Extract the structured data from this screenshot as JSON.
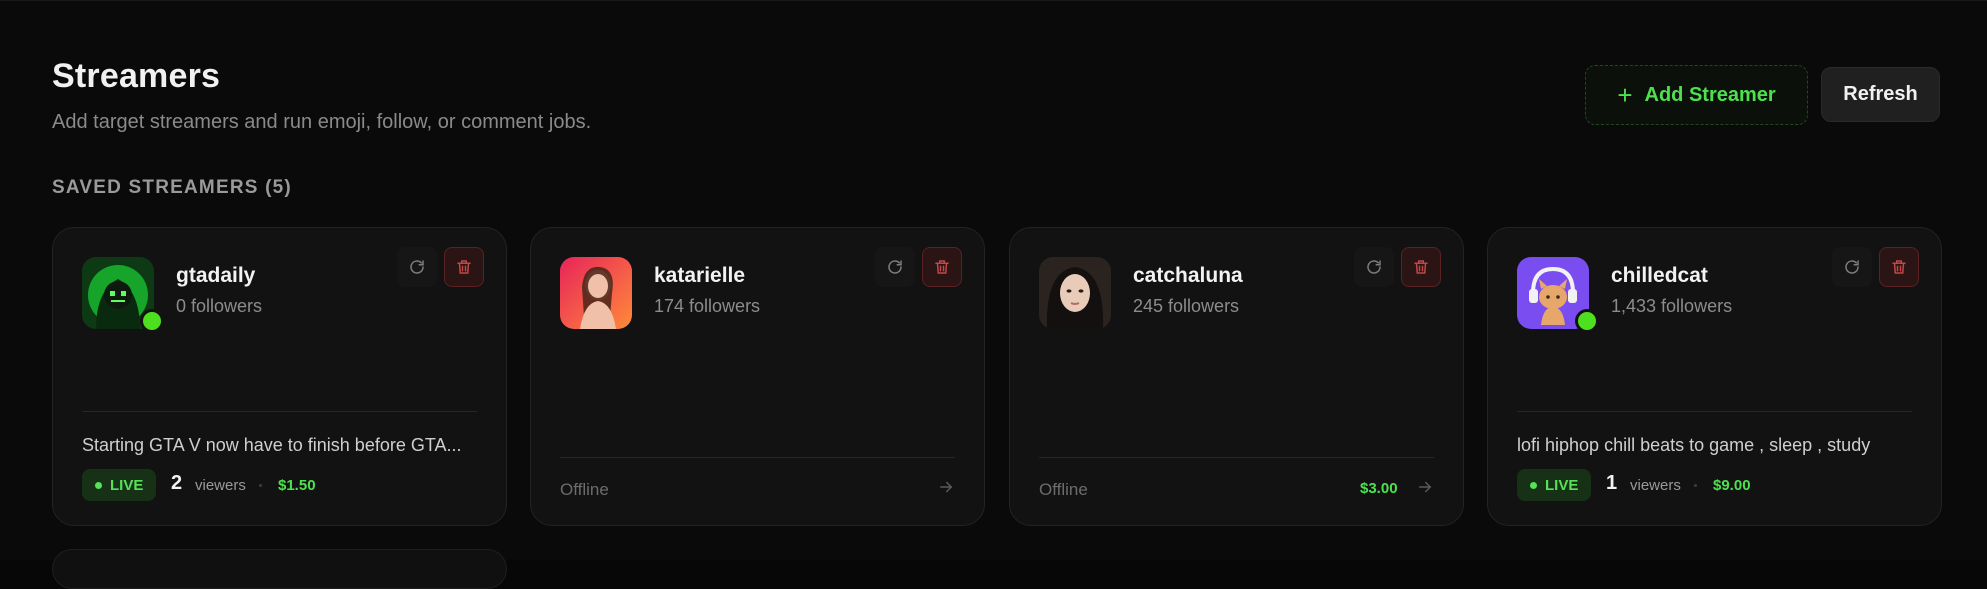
{
  "header": {
    "title": "Streamers",
    "subtitle": "Add target streamers and run emoji, follow, or comment jobs.",
    "add_label": "Add Streamer",
    "refresh_label": "Refresh"
  },
  "section": {
    "label": "SAVED STREAMERS (5)"
  },
  "colors": {
    "accent_green": "#4ee04e",
    "danger": "#c24848",
    "background": "#0a0a0a",
    "card": "#121212"
  },
  "icons": {
    "add": "plus-icon",
    "card_refresh": "refresh-icon",
    "card_delete": "trash-icon",
    "card_arrow": "arrow-right-icon"
  },
  "streamers": [
    {
      "name": "gtadaily",
      "followers": "0 followers",
      "online": true,
      "stream_title": "Starting GTA V now have to finish before GTA...",
      "status": "LIVE",
      "viewers": "2",
      "viewers_label": "viewers",
      "price": "$1.50"
    },
    {
      "name": "katarielle",
      "followers": "174 followers",
      "online": false,
      "status": "Offline"
    },
    {
      "name": "catchaluna",
      "followers": "245 followers",
      "online": false,
      "status": "Offline",
      "price": "$3.00"
    },
    {
      "name": "chilledcat",
      "followers": "1,433 followers",
      "online": true,
      "stream_title": "lofi hiphop chill beats to game , sleep , study",
      "status": "LIVE",
      "viewers": "1",
      "viewers_label": "viewers",
      "price": "$9.00"
    }
  ]
}
